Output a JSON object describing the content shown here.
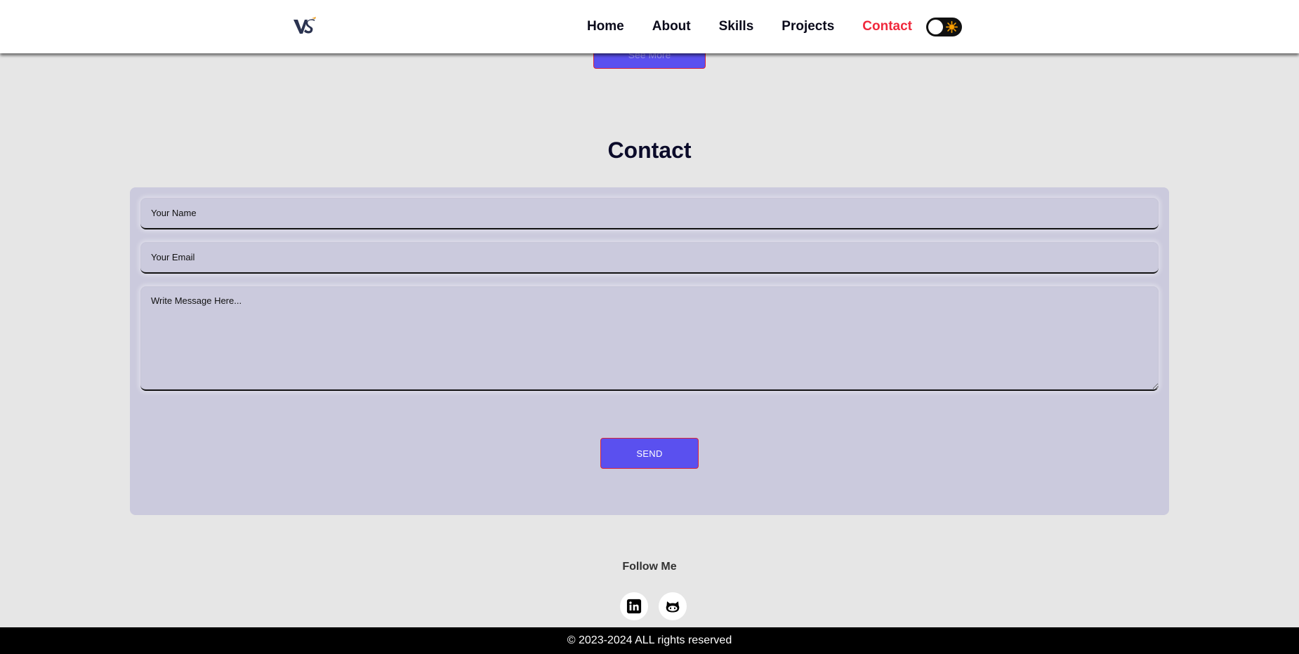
{
  "header": {
    "logo_alt": "VS",
    "nav": [
      {
        "label": "Home"
      },
      {
        "label": "About"
      },
      {
        "label": "Skills"
      },
      {
        "label": "Projects"
      },
      {
        "label": "Contact"
      }
    ],
    "active_nav": "Contact",
    "theme_toggle_icon": "sun-icon"
  },
  "projects": {
    "see_more_label": "See More"
  },
  "contact": {
    "title": "Contact",
    "name_placeholder": "Your Name",
    "name_value": "",
    "email_placeholder": "Your Email",
    "email_value": "",
    "message_placeholder": "Write Message Here...",
    "message_value": "",
    "send_label": "SEND"
  },
  "follow": {
    "title": "Follow Me",
    "links": [
      {
        "icon": "linkedin-icon"
      },
      {
        "icon": "github-icon"
      }
    ]
  },
  "footer": {
    "copyright": "© 2023-2024 ALL rights reserved"
  },
  "colors": {
    "accent": "#5a50ef",
    "active_nav": "#f0283c",
    "background": "#e6e6e6",
    "form_bg": "#cbcadd",
    "footer_bg": "#000000"
  }
}
